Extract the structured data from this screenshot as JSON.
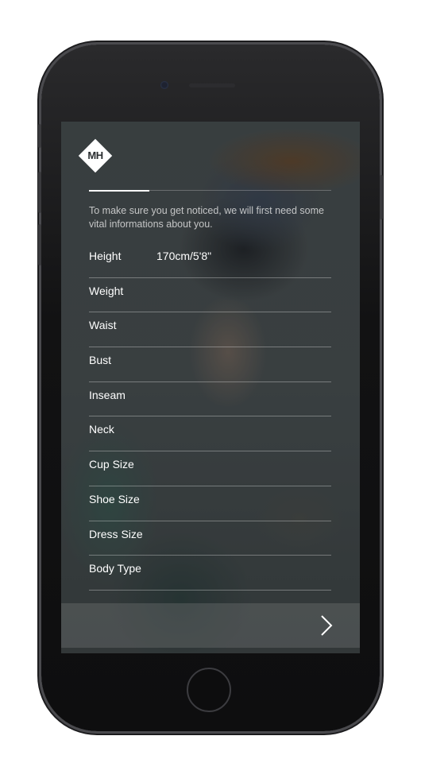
{
  "app": {
    "logo_text": "MH"
  },
  "onboarding": {
    "progress": 0.25,
    "intro_text": "To make sure you get noticed, we will first need some vital informations about you.",
    "fields": [
      {
        "label": "Height",
        "value": "170cm/5'8\""
      },
      {
        "label": "Weight",
        "value": ""
      },
      {
        "label": "Waist",
        "value": ""
      },
      {
        "label": "Bust",
        "value": ""
      },
      {
        "label": "Inseam",
        "value": ""
      },
      {
        "label": "Neck",
        "value": ""
      },
      {
        "label": "Cup Size",
        "value": ""
      },
      {
        "label": "Shoe Size",
        "value": ""
      },
      {
        "label": "Dress Size",
        "value": ""
      },
      {
        "label": "Body Type",
        "value": ""
      }
    ]
  },
  "navigation": {
    "next_icon": "chevron-right-icon"
  },
  "colors": {
    "text": "#ffffff",
    "divider": "rgba(255,255,255,0.32)",
    "logo_bg": "#ffffff"
  }
}
